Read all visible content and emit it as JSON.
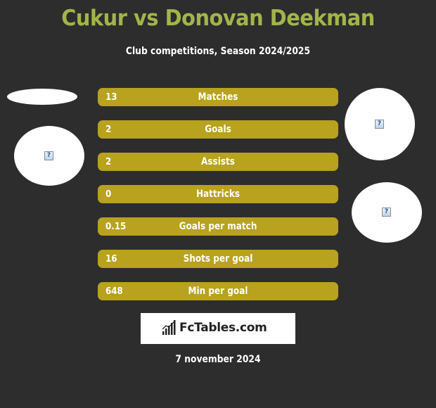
{
  "header": {
    "title": "Cukur vs Donovan Deekman",
    "subtitle": "Club competitions, Season 2024/2025"
  },
  "colors": {
    "background": "#2d2d2d",
    "title": "#a2b54a",
    "bar": "#b8a21e"
  },
  "left_player": {
    "images": [
      {
        "icon": "image-placeholder-icon",
        "glyph": ""
      },
      {
        "icon": "broken-image-icon",
        "glyph": "?"
      }
    ]
  },
  "right_player": {
    "images": [
      {
        "icon": "broken-image-icon",
        "glyph": "?"
      },
      {
        "icon": "broken-image-icon",
        "glyph": "?"
      }
    ]
  },
  "stats": [
    {
      "value": "13",
      "label": "Matches"
    },
    {
      "value": "2",
      "label": "Goals"
    },
    {
      "value": "2",
      "label": "Assists"
    },
    {
      "value": "0",
      "label": "Hattricks"
    },
    {
      "value": "0.15",
      "label": "Goals per match"
    },
    {
      "value": "16",
      "label": "Shots per goal"
    },
    {
      "value": "648",
      "label": "Min per goal"
    }
  ],
  "footer": {
    "brand": "FcTables.com",
    "brand_icon": "bar-chart-icon",
    "date": "7 november 2024"
  }
}
